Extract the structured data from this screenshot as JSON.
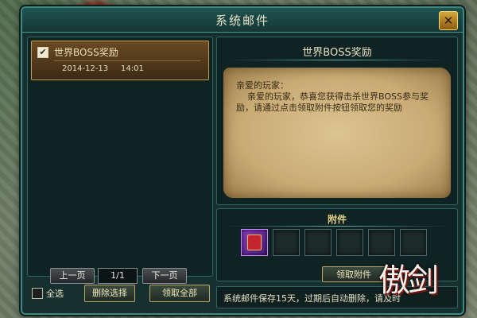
{
  "window": {
    "title": "系统邮件",
    "close_label": "✕"
  },
  "mail_list": {
    "items": [
      {
        "title": "世界BOSS奖励",
        "date": "2014-12-13",
        "time": "14:01",
        "checked": true
      }
    ]
  },
  "pager": {
    "prev_label": "上一页",
    "page": "1/1",
    "next_label": "下一页"
  },
  "bottom": {
    "select_all_label": "全选",
    "delete_label": "删除选择",
    "claim_all_label": "领取全部"
  },
  "detail": {
    "subject": "世界BOSS奖励",
    "body": "亲爱的玩家：\n    亲爱的玩家，恭喜您获得击杀世界BOSS参与奖励，请通过点击领取附件按钮领取您的奖励"
  },
  "attachments": {
    "title": "附件",
    "slots": 6,
    "claim_label": "领取附件"
  },
  "notice": {
    "text": "系统邮件保存15天，过期后自动删除，请及时"
  },
  "logo": {
    "text": "傲剑"
  },
  "colors": {
    "accent": "#3e8a83",
    "gold": "#c49a4a",
    "parchment": "#dcc493"
  }
}
